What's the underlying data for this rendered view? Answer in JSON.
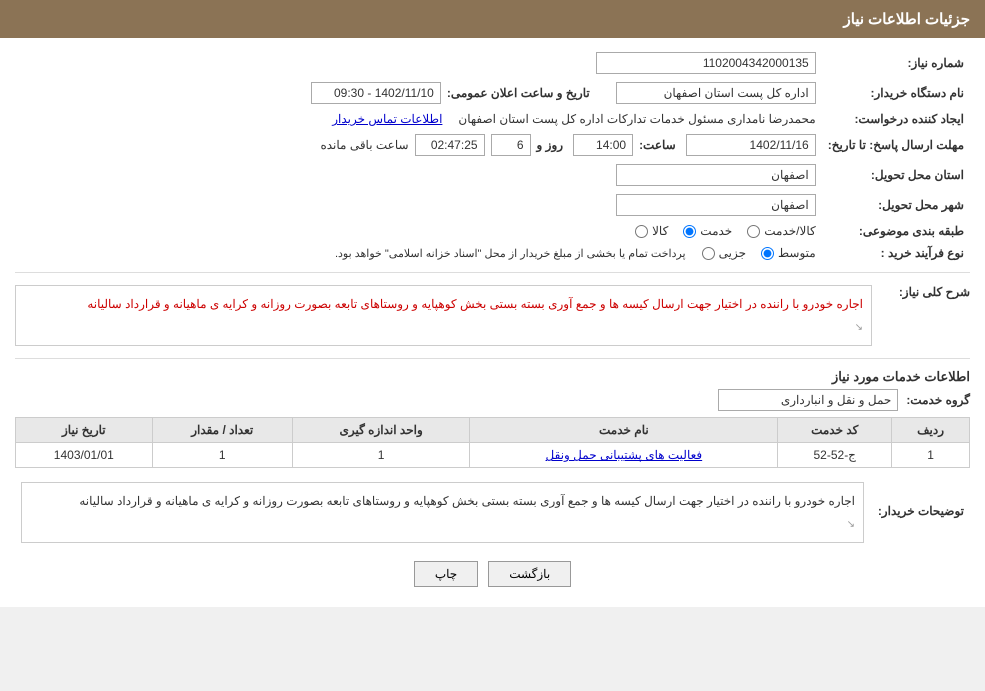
{
  "header": {
    "title": "جزئیات اطلاعات نیاز"
  },
  "fields": {
    "need_number_label": "شماره نیاز:",
    "need_number_value": "1102004342000135",
    "org_name_label": "نام دستگاه خریدار:",
    "org_name_value": "اداره کل پست استان اصفهان",
    "announce_date_label": "تاریخ و ساعت اعلان عمومی:",
    "announce_date_value": "1402/11/10 - 09:30",
    "creator_label": "ایجاد کننده درخواست:",
    "creator_value": "محمدرضا نامداری مسئول خدمات تدارکات اداره کل پست استان اصفهان",
    "creator_link": "اطلاعات تماس خریدار",
    "reply_deadline_label": "مهلت ارسال پاسخ: تا تاریخ:",
    "reply_date_value": "1402/11/16",
    "reply_time_label": "ساعت:",
    "reply_time_value": "14:00",
    "reply_days_label": "روز و",
    "reply_days_value": "6",
    "reply_remaining_label": "ساعت باقی مانده",
    "reply_remaining_value": "02:47:25",
    "province_label": "استان محل تحویل:",
    "province_value": "اصفهان",
    "city_label": "شهر محل تحویل:",
    "city_value": "اصفهان",
    "category_label": "طبقه بندی موضوعی:",
    "category_options": [
      "کالا",
      "خدمت",
      "کالا/خدمت"
    ],
    "category_selected": "خدمت",
    "purchase_type_label": "نوع فرآیند خرید :",
    "purchase_type_options": [
      "جزیی",
      "متوسط"
    ],
    "purchase_type_selected": "متوسط",
    "purchase_type_note": "پرداخت تمام یا بخشی از مبلغ خریدار از محل \"اسناد خزانه اسلامی\" خواهد بود."
  },
  "need_description": {
    "section_title": "شرح کلی نیاز:",
    "text": "اجاره خودرو با راننده در اختیار جهت ارسال کیسه ها و جمع آوری بسته بستی بخش کوهپایه و روستاهای تابعه بصورت روزانه و کرایه ی ماهیانه و قرارداد سالیانه"
  },
  "service_info": {
    "section_title": "اطلاعات خدمات مورد نیاز",
    "service_group_label": "گروه خدمت:",
    "service_group_value": "حمل و نقل و انبارداری"
  },
  "table": {
    "columns": [
      "ردیف",
      "کد خدمت",
      "نام خدمت",
      "واحد اندازه گیری",
      "تعداد / مقدار",
      "تاریخ نیاز"
    ],
    "rows": [
      {
        "row_num": "1",
        "service_code": "ج-52-52",
        "service_name": "فعالیت های پشتیبانی حمل ونقل",
        "unit": "1",
        "quantity": "1",
        "date": "1403/01/01"
      }
    ]
  },
  "buyer_description": {
    "label": "توضیحات خریدار:",
    "text": "اجاره خودرو با راننده در اختیار جهت ارسال کیسه ها و جمع آوری بسته بستی بخش کوهپایه و روستاهای تابعه بصورت روزانه و کرایه ی ماهیانه و قرارداد سالیانه"
  },
  "buttons": {
    "print_label": "چاپ",
    "back_label": "بازگشت"
  }
}
